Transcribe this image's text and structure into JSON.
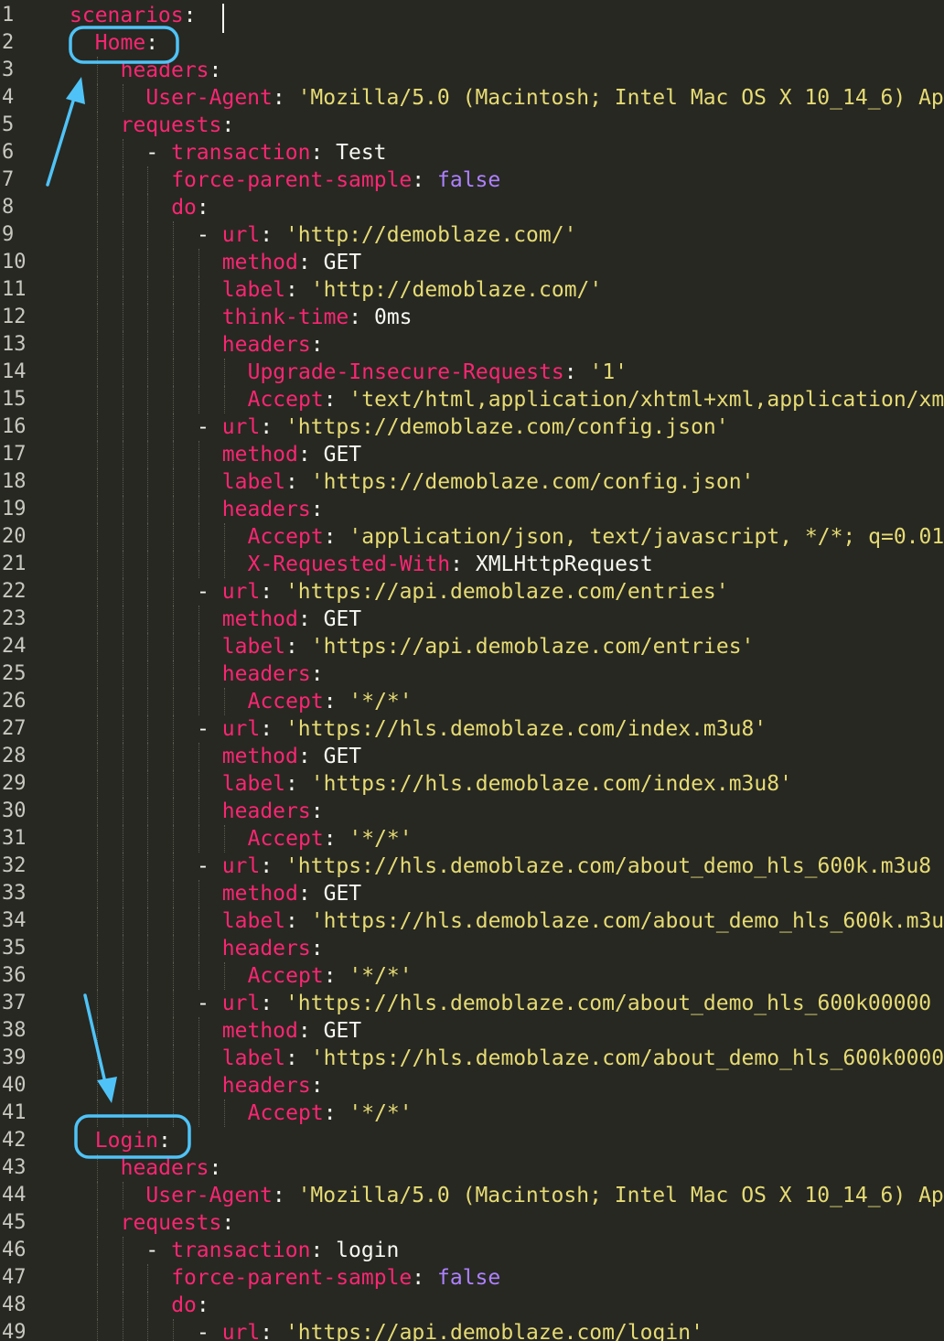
{
  "editor": {
    "lines": [
      {
        "n": "1",
        "indent": 0,
        "parts": [
          [
            "k",
            "scenarios"
          ],
          [
            "p",
            ":"
          ]
        ]
      },
      {
        "n": "2",
        "indent": 1,
        "parts": [
          [
            "k",
            "Home"
          ],
          [
            "p",
            ":"
          ]
        ]
      },
      {
        "n": "3",
        "indent": 2,
        "parts": [
          [
            "k",
            "headers"
          ],
          [
            "p",
            ":"
          ]
        ]
      },
      {
        "n": "4",
        "indent": 3,
        "parts": [
          [
            "k",
            "User-Agent"
          ],
          [
            "p",
            ": "
          ],
          [
            "s",
            "'Mozilla/5.0 (Macintosh; Intel Mac OS X 10_14_6) Ap"
          ]
        ]
      },
      {
        "n": "5",
        "indent": 2,
        "parts": [
          [
            "k",
            "requests"
          ],
          [
            "p",
            ":"
          ]
        ]
      },
      {
        "n": "6",
        "indent": 3,
        "parts": [
          [
            "p",
            "- "
          ],
          [
            "k",
            "transaction"
          ],
          [
            "p",
            ": "
          ],
          [
            "v",
            "Test"
          ]
        ]
      },
      {
        "n": "7",
        "indent": 4,
        "parts": [
          [
            "k",
            "force-parent-sample"
          ],
          [
            "p",
            ": "
          ],
          [
            "b",
            "false"
          ]
        ]
      },
      {
        "n": "8",
        "indent": 4,
        "parts": [
          [
            "k",
            "do"
          ],
          [
            "p",
            ":"
          ]
        ]
      },
      {
        "n": "9",
        "indent": 5,
        "parts": [
          [
            "p",
            "- "
          ],
          [
            "k",
            "url"
          ],
          [
            "p",
            ": "
          ],
          [
            "s",
            "'http://demoblaze.com/'"
          ]
        ]
      },
      {
        "n": "10",
        "indent": 6,
        "parts": [
          [
            "k",
            "method"
          ],
          [
            "p",
            ": "
          ],
          [
            "v",
            "GET"
          ]
        ]
      },
      {
        "n": "11",
        "indent": 6,
        "parts": [
          [
            "k",
            "label"
          ],
          [
            "p",
            ": "
          ],
          [
            "s",
            "'http://demoblaze.com/'"
          ]
        ]
      },
      {
        "n": "12",
        "indent": 6,
        "parts": [
          [
            "k",
            "think-time"
          ],
          [
            "p",
            ": "
          ],
          [
            "v",
            "0ms"
          ]
        ]
      },
      {
        "n": "13",
        "indent": 6,
        "parts": [
          [
            "k",
            "headers"
          ],
          [
            "p",
            ":"
          ]
        ]
      },
      {
        "n": "14",
        "indent": 7,
        "parts": [
          [
            "k",
            "Upgrade-Insecure-Requests"
          ],
          [
            "p",
            ": "
          ],
          [
            "s",
            "'1'"
          ]
        ]
      },
      {
        "n": "15",
        "indent": 7,
        "parts": [
          [
            "k",
            "Accept"
          ],
          [
            "p",
            ": "
          ],
          [
            "s",
            "'text/html,application/xhtml+xml,application/xm"
          ]
        ]
      },
      {
        "n": "16",
        "indent": 5,
        "parts": [
          [
            "p",
            "- "
          ],
          [
            "k",
            "url"
          ],
          [
            "p",
            ": "
          ],
          [
            "s",
            "'https://demoblaze.com/config.json'"
          ]
        ]
      },
      {
        "n": "17",
        "indent": 6,
        "parts": [
          [
            "k",
            "method"
          ],
          [
            "p",
            ": "
          ],
          [
            "v",
            "GET"
          ]
        ]
      },
      {
        "n": "18",
        "indent": 6,
        "parts": [
          [
            "k",
            "label"
          ],
          [
            "p",
            ": "
          ],
          [
            "s",
            "'https://demoblaze.com/config.json'"
          ]
        ]
      },
      {
        "n": "19",
        "indent": 6,
        "parts": [
          [
            "k",
            "headers"
          ],
          [
            "p",
            ":"
          ]
        ]
      },
      {
        "n": "20",
        "indent": 7,
        "parts": [
          [
            "k",
            "Accept"
          ],
          [
            "p",
            ": "
          ],
          [
            "s",
            "'application/json, text/javascript, */*; q=0.01"
          ]
        ]
      },
      {
        "n": "21",
        "indent": 7,
        "parts": [
          [
            "k",
            "X-Requested-With"
          ],
          [
            "p",
            ": "
          ],
          [
            "v",
            "XMLHttpRequest"
          ]
        ]
      },
      {
        "n": "22",
        "indent": 5,
        "parts": [
          [
            "p",
            "- "
          ],
          [
            "k",
            "url"
          ],
          [
            "p",
            ": "
          ],
          [
            "s",
            "'https://api.demoblaze.com/entries'"
          ]
        ]
      },
      {
        "n": "23",
        "indent": 6,
        "parts": [
          [
            "k",
            "method"
          ],
          [
            "p",
            ": "
          ],
          [
            "v",
            "GET"
          ]
        ]
      },
      {
        "n": "24",
        "indent": 6,
        "parts": [
          [
            "k",
            "label"
          ],
          [
            "p",
            ": "
          ],
          [
            "s",
            "'https://api.demoblaze.com/entries'"
          ]
        ]
      },
      {
        "n": "25",
        "indent": 6,
        "parts": [
          [
            "k",
            "headers"
          ],
          [
            "p",
            ":"
          ]
        ]
      },
      {
        "n": "26",
        "indent": 7,
        "parts": [
          [
            "k",
            "Accept"
          ],
          [
            "p",
            ": "
          ],
          [
            "s",
            "'*/*'"
          ]
        ]
      },
      {
        "n": "27",
        "indent": 5,
        "parts": [
          [
            "p",
            "- "
          ],
          [
            "k",
            "url"
          ],
          [
            "p",
            ": "
          ],
          [
            "s",
            "'https://hls.demoblaze.com/index.m3u8'"
          ]
        ]
      },
      {
        "n": "28",
        "indent": 6,
        "parts": [
          [
            "k",
            "method"
          ],
          [
            "p",
            ": "
          ],
          [
            "v",
            "GET"
          ]
        ]
      },
      {
        "n": "29",
        "indent": 6,
        "parts": [
          [
            "k",
            "label"
          ],
          [
            "p",
            ": "
          ],
          [
            "s",
            "'https://hls.demoblaze.com/index.m3u8'"
          ]
        ]
      },
      {
        "n": "30",
        "indent": 6,
        "parts": [
          [
            "k",
            "headers"
          ],
          [
            "p",
            ":"
          ]
        ]
      },
      {
        "n": "31",
        "indent": 7,
        "parts": [
          [
            "k",
            "Accept"
          ],
          [
            "p",
            ": "
          ],
          [
            "s",
            "'*/*'"
          ]
        ]
      },
      {
        "n": "32",
        "indent": 5,
        "parts": [
          [
            "p",
            "- "
          ],
          [
            "k",
            "url"
          ],
          [
            "p",
            ": "
          ],
          [
            "s",
            "'https://hls.demoblaze.com/about_demo_hls_600k.m3u8"
          ]
        ]
      },
      {
        "n": "33",
        "indent": 6,
        "parts": [
          [
            "k",
            "method"
          ],
          [
            "p",
            ": "
          ],
          [
            "v",
            "GET"
          ]
        ]
      },
      {
        "n": "34",
        "indent": 6,
        "parts": [
          [
            "k",
            "label"
          ],
          [
            "p",
            ": "
          ],
          [
            "s",
            "'https://hls.demoblaze.com/about_demo_hls_600k.m3u"
          ]
        ]
      },
      {
        "n": "35",
        "indent": 6,
        "parts": [
          [
            "k",
            "headers"
          ],
          [
            "p",
            ":"
          ]
        ]
      },
      {
        "n": "36",
        "indent": 7,
        "parts": [
          [
            "k",
            "Accept"
          ],
          [
            "p",
            ": "
          ],
          [
            "s",
            "'*/*'"
          ]
        ]
      },
      {
        "n": "37",
        "indent": 5,
        "parts": [
          [
            "p",
            "- "
          ],
          [
            "k",
            "url"
          ],
          [
            "p",
            ": "
          ],
          [
            "s",
            "'https://hls.demoblaze.com/about_demo_hls_600k00000"
          ]
        ]
      },
      {
        "n": "38",
        "indent": 6,
        "parts": [
          [
            "k",
            "method"
          ],
          [
            "p",
            ": "
          ],
          [
            "v",
            "GET"
          ]
        ]
      },
      {
        "n": "39",
        "indent": 6,
        "parts": [
          [
            "k",
            "label"
          ],
          [
            "p",
            ": "
          ],
          [
            "s",
            "'https://hls.demoblaze.com/about_demo_hls_600k0000"
          ]
        ]
      },
      {
        "n": "40",
        "indent": 6,
        "parts": [
          [
            "k",
            "headers"
          ],
          [
            "p",
            ":"
          ]
        ]
      },
      {
        "n": "41",
        "indent": 7,
        "parts": [
          [
            "k",
            "Accept"
          ],
          [
            "p",
            ": "
          ],
          [
            "s",
            "'*/*'"
          ]
        ]
      },
      {
        "n": "42",
        "indent": 1,
        "parts": [
          [
            "k",
            "Login"
          ],
          [
            "p",
            ":"
          ]
        ]
      },
      {
        "n": "43",
        "indent": 2,
        "parts": [
          [
            "k",
            "headers"
          ],
          [
            "p",
            ":"
          ]
        ]
      },
      {
        "n": "44",
        "indent": 3,
        "parts": [
          [
            "k",
            "User-Agent"
          ],
          [
            "p",
            ": "
          ],
          [
            "s",
            "'Mozilla/5.0 (Macintosh; Intel Mac OS X 10_14_6) Ap"
          ]
        ]
      },
      {
        "n": "45",
        "indent": 2,
        "parts": [
          [
            "k",
            "requests"
          ],
          [
            "p",
            ":"
          ]
        ]
      },
      {
        "n": "46",
        "indent": 3,
        "parts": [
          [
            "p",
            "- "
          ],
          [
            "k",
            "transaction"
          ],
          [
            "p",
            ": "
          ],
          [
            "v",
            "login"
          ]
        ]
      },
      {
        "n": "47",
        "indent": 4,
        "parts": [
          [
            "k",
            "force-parent-sample"
          ],
          [
            "p",
            ": "
          ],
          [
            "b",
            "false"
          ]
        ]
      },
      {
        "n": "48",
        "indent": 4,
        "parts": [
          [
            "k",
            "do"
          ],
          [
            "p",
            ":"
          ]
        ]
      },
      {
        "n": "49",
        "indent": 5,
        "parts": [
          [
            "p",
            "- "
          ],
          [
            "k",
            "url"
          ],
          [
            "p",
            ": "
          ],
          [
            "s",
            "'https://api.demoblaze.com/login'"
          ]
        ]
      }
    ]
  },
  "theme": {
    "background": "#272822",
    "key": "#f92672",
    "string": "#e6db74",
    "boolean": "#ae81ff",
    "text": "#f8f8f2",
    "annotation": "#4fc3f7"
  },
  "annotations": {
    "highlighted_keys": [
      "Home",
      "Login"
    ],
    "arrow_count": 2
  }
}
